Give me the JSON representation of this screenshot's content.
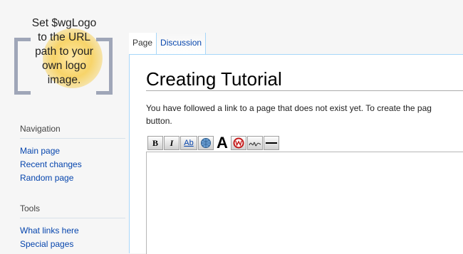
{
  "logo": {
    "lines": [
      "Set $wgLogo",
      "to the URL",
      "path to your",
      "own logo",
      "image."
    ]
  },
  "sidebar": {
    "navigation": {
      "heading": "Navigation",
      "items": [
        "Main page",
        "Recent changes",
        "Random page"
      ]
    },
    "tools": {
      "heading": "Tools",
      "items": [
        "What links here",
        "Special pages"
      ]
    }
  },
  "tabs": [
    {
      "label": "Page"
    },
    {
      "label": "Discussion"
    }
  ],
  "page": {
    "title": "Creating Tutorial",
    "notice_line1": "You have followed a link to a page that does not exist yet. To create the pag",
    "notice_line2": "button."
  },
  "toolbar": {
    "bold_label": "B",
    "italic_label": "I",
    "link_label": "Ab",
    "headline_label": "A"
  },
  "colors": {
    "link": "#0645ad",
    "tab_border": "#a7d7f9"
  }
}
